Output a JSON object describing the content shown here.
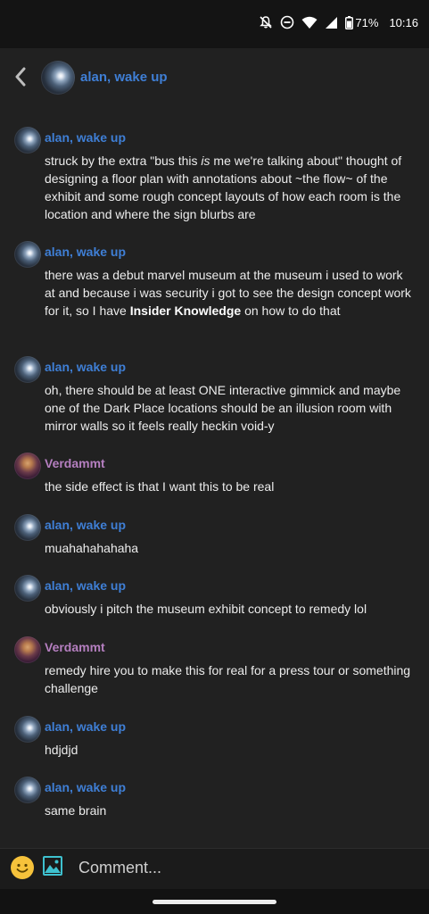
{
  "status_bar": {
    "battery": "71%",
    "time": "10:16",
    "icons": [
      "notifications-off-icon",
      "do-not-disturb-icon",
      "wifi-icon",
      "cell-signal-icon",
      "battery-icon"
    ]
  },
  "header": {
    "title": "alan, wake up",
    "back_icon": "chevron-left-icon"
  },
  "messages": [
    {
      "author": "alan, wake up",
      "text_before": "struck by the extra \"bus this ",
      "text_italic": "is",
      "text_after": " me we're talking about\" thought of designing a floor plan with annotations about ~the flow~ of the exhibit and some rough concept layouts of how each room is the location and where the sign blurbs are"
    },
    {
      "author": "alan, wake up",
      "text_before": "there was a debut marvel museum at the museum i used to work at and because i was security i got to see the design concept work for it, so I have ",
      "text_bold": "Insider Knowledge",
      "text_after": " on how to do that"
    },
    {
      "author": "alan, wake up",
      "text": "oh, there should be at least ONE interactive gimmick and maybe one of the Dark Place locations should be an illusion room with mirror walls so it feels really heckin void-y"
    },
    {
      "author": "Verdammt",
      "text": "the side effect is that I want this to be real"
    },
    {
      "author": "alan, wake up",
      "text": "muahahahahaha"
    },
    {
      "author": "alan, wake up",
      "text": "obviously i pitch the museum exhibit concept to remedy lol"
    },
    {
      "author": "Verdammt",
      "text": "remedy hire you to make this for real for a press tour or something challenge"
    },
    {
      "author": "alan, wake up",
      "text": "hdjdjd"
    },
    {
      "author": "alan, wake up",
      "text": "same brain"
    }
  ],
  "comment_bar": {
    "placeholder": "Comment...",
    "emoji_icon": "emoji-icon",
    "image_icon": "image-icon"
  },
  "colors": {
    "background": "#212121",
    "author_blue": "#3f7fd6",
    "author_purple": "#b57fc0",
    "text": "#ececec"
  }
}
